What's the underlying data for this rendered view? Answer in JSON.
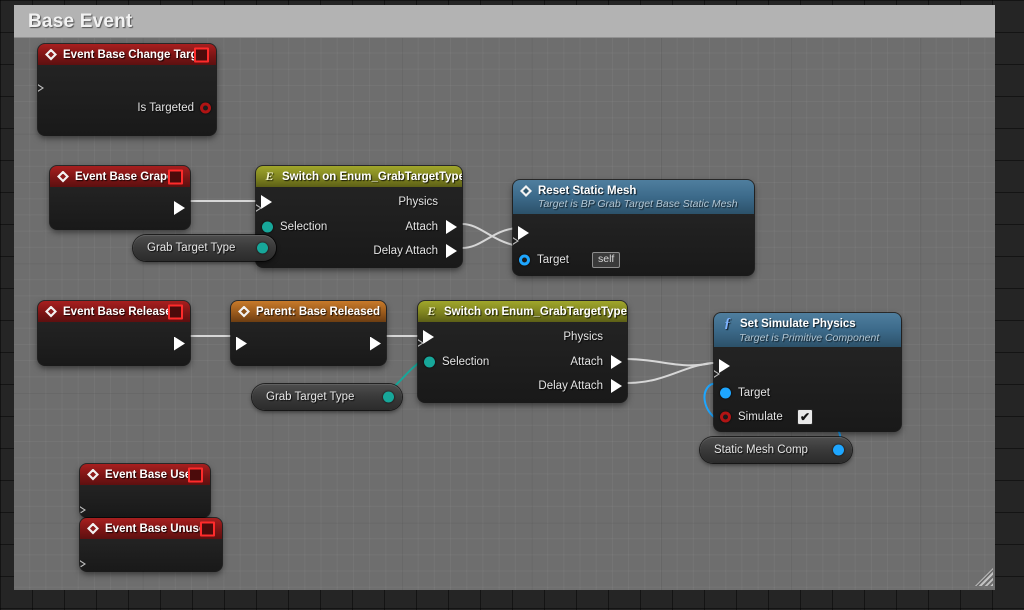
{
  "window": {
    "title": "Base Event",
    "resize_grip": "resize-grip"
  },
  "graph": {
    "nodes": [
      {
        "id": "event-base-change-target",
        "title": "Event Base Change Target",
        "kind": "event",
        "icon": "event-diamond-icon",
        "has_delegate_pin": true,
        "outputs": [
          {
            "label": "",
            "type": "exec"
          },
          {
            "label": "Is Targeted",
            "type": "bool"
          }
        ]
      },
      {
        "id": "event-base-graped",
        "title": "Event Base Graped",
        "kind": "event",
        "icon": "event-diamond-icon",
        "has_delegate_pin": true,
        "outputs": [
          {
            "label": "",
            "type": "exec"
          }
        ]
      },
      {
        "id": "switch-on-enum-1",
        "title": "Switch on Enum_GrabTargetType",
        "kind": "switch",
        "icon": "enum-icon",
        "inputs": [
          {
            "label": "",
            "type": "exec"
          },
          {
            "label": "Selection",
            "type": "enum"
          }
        ],
        "outputs": [
          {
            "label": "Physics",
            "type": "exec"
          },
          {
            "label": "Attach",
            "type": "exec"
          },
          {
            "label": "Delay Attach",
            "type": "exec"
          }
        ]
      },
      {
        "id": "reset-static-mesh",
        "title": "Reset Static Mesh",
        "subtitle": "Target is BP Grab Target Base Static Mesh",
        "kind": "function",
        "icon": "event-diamond-icon",
        "inputs": [
          {
            "label": "",
            "type": "exec"
          },
          {
            "label": "Target",
            "type": "object",
            "value": "self"
          }
        ],
        "outputs": [
          {
            "label": "",
            "type": "exec"
          }
        ]
      },
      {
        "id": "event-base-released",
        "title": "Event Base Released",
        "kind": "event",
        "icon": "event-diamond-icon",
        "has_delegate_pin": true,
        "outputs": [
          {
            "label": "",
            "type": "exec"
          }
        ]
      },
      {
        "id": "parent-base-released",
        "title": "Parent: Base Released",
        "kind": "parent",
        "icon": "event-diamond-icon",
        "inputs": [
          {
            "label": "",
            "type": "exec"
          }
        ],
        "outputs": [
          {
            "label": "",
            "type": "exec"
          }
        ]
      },
      {
        "id": "switch-on-enum-2",
        "title": "Switch on Enum_GrabTargetType",
        "kind": "switch",
        "icon": "enum-icon",
        "inputs": [
          {
            "label": "",
            "type": "exec"
          },
          {
            "label": "Selection",
            "type": "enum"
          }
        ],
        "outputs": [
          {
            "label": "Physics",
            "type": "exec"
          },
          {
            "label": "Attach",
            "type": "exec"
          },
          {
            "label": "Delay Attach",
            "type": "exec"
          }
        ]
      },
      {
        "id": "set-simulate-physics",
        "title": "Set Simulate Physics",
        "subtitle": "Target is Primitive Component",
        "kind": "function",
        "icon": "function-fx-icon",
        "inputs": [
          {
            "label": "",
            "type": "exec"
          },
          {
            "label": "Target",
            "type": "object"
          },
          {
            "label": "Simulate",
            "type": "bool",
            "checked": true
          }
        ],
        "outputs": [
          {
            "label": "",
            "type": "exec"
          }
        ]
      },
      {
        "id": "event-base-used",
        "title": "Event Base Used",
        "kind": "event",
        "icon": "event-diamond-icon",
        "has_delegate_pin": true,
        "outputs": [
          {
            "label": "",
            "type": "exec"
          }
        ]
      },
      {
        "id": "event-base-unused",
        "title": "Event Base Unused",
        "kind": "event",
        "icon": "event-diamond-icon",
        "has_delegate_pin": true,
        "outputs": [
          {
            "label": "",
            "type": "exec"
          }
        ]
      }
    ],
    "variables": [
      {
        "id": "grab-target-type-1",
        "label": "Grab Target Type",
        "pin_type": "enum"
      },
      {
        "id": "grab-target-type-2",
        "label": "Grab Target Type",
        "pin_type": "enum"
      },
      {
        "id": "static-mesh-comp",
        "label": "Static Mesh Comp",
        "pin_type": "object"
      }
    ]
  },
  "labels": {
    "n1_title": "Event Base Change Target",
    "n1_out2": "Is Targeted",
    "n2_title": "Event Base Graped",
    "n3_title": "Switch on Enum_GrabTargetType",
    "n3_in2": "Selection",
    "n3_o1": "Physics",
    "n3_o2": "Attach",
    "n3_o3": "Delay Attach",
    "n4_title": "Reset Static Mesh",
    "n4_sub": "Target is BP Grab Target Base Static Mesh",
    "n4_target": "Target",
    "n4_target_value": "self",
    "n5_title": "Event Base Released",
    "n6_title": "Parent: Base Released",
    "n7_title": "Switch on Enum_GrabTargetType",
    "n7_in2": "Selection",
    "n7_o1": "Physics",
    "n7_o2": "Attach",
    "n7_o3": "Delay Attach",
    "n8_title": "Set Simulate Physics",
    "n8_sub": "Target is Primitive Component",
    "n8_target": "Target",
    "n8_simulate": "Simulate",
    "n8_check": "✔",
    "n9_title": "Event Base Used",
    "n10_title": "Event Base Unused",
    "v1": "Grab Target Type",
    "v2": "Grab Target Type",
    "v3": "Static Mesh Comp",
    "enum_glyph": "E",
    "fx_glyph": "ƒ"
  },
  "colors": {
    "panel_bg": "#6e6e6e",
    "backdrop_bg": "#252525",
    "titlebar_bg": "#b3b3b3",
    "event_red": "#a81f1f",
    "parent_orange": "#c87a2a",
    "switch_olive": "#a0a62b",
    "function_blue": "#4f7e9e",
    "exec_wire": "#d7d7d7",
    "enum_wire": "#17a79a",
    "object_wire": "#1ea6ff"
  }
}
